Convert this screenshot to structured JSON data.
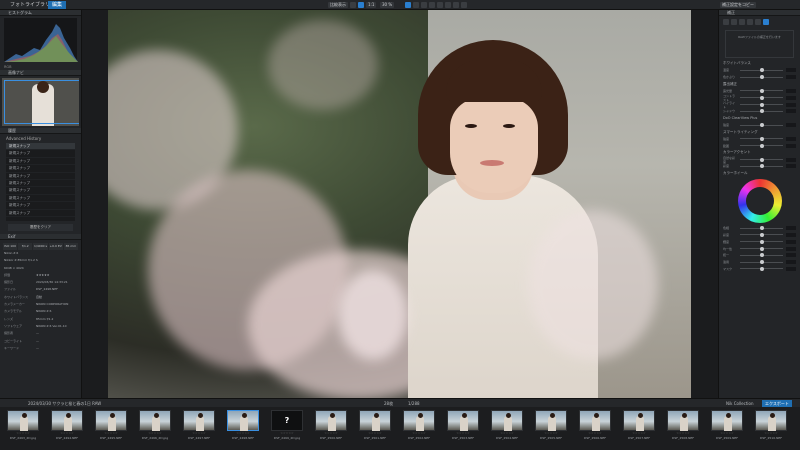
{
  "topbar": {
    "tabs": [
      {
        "label": "フォトライブラリ",
        "active": false
      },
      {
        "label": "編集",
        "active": true
      }
    ],
    "compare_label": "比較表示",
    "zoom_label": "1:1",
    "zoom_value": "30 %",
    "export_label": "補正設定をコピー"
  },
  "left_panel": {
    "histogram_title": "ヒストグラム",
    "histogram_mode": "RGB",
    "navigator_title": "画像ナビ",
    "history_title": "履歴",
    "history_header": "Advanced History",
    "history_items": [
      "新規スナップ",
      "新規スナップ",
      "新規スナップ",
      "新規スナップ",
      "新規スナップ",
      "新規スナップ",
      "新規スナップ",
      "新規スナップ",
      "新規スナップ",
      "新規スナップ"
    ],
    "clear_button": "履歴をクリア",
    "exif_title": "Exif",
    "exif_values": [
      "ISO 100",
      "f/1.2",
      "1/4000 s",
      "+0.0 EV",
      "85 mm"
    ],
    "camera": "Nikon Z 6",
    "lens": "Nikkor Z 85mm f/1.2 S",
    "resolution": "6048 × 4024",
    "info_rows": [
      {
        "k": "評価",
        "v": "★★★★★"
      },
      {
        "k": "撮影日",
        "v": "2024/03/30 14:33:21"
      },
      {
        "k": "ファイル",
        "v": "DSF_2498.NEF"
      },
      {
        "k": "ホワイトバランス",
        "v": "自動"
      },
      {
        "k": "カメラメーカー",
        "v": "NIKON CORPORATION"
      },
      {
        "k": "カメラモデル",
        "v": "NIKON Z 6"
      },
      {
        "k": "レンズ",
        "v": "85mm f/1.2"
      },
      {
        "k": "ソフトウェア",
        "v": "NIKON Z 6 Ver.01.10"
      },
      {
        "k": "撮影者",
        "v": "—"
      },
      {
        "k": "コピーライト",
        "v": "—"
      },
      {
        "k": "キーワード",
        "v": "—"
      }
    ]
  },
  "right_panel": {
    "title": "補正",
    "note_text": "RAWファイルの補正を行います",
    "sections": [
      {
        "title": "ホワイトバランス",
        "rows": [
          "温度",
          "色かぶり"
        ]
      },
      {
        "title": "露出補正",
        "rows": [
          "露光量",
          "コントラスト",
          "ハイライト",
          "シャドウ"
        ]
      },
      {
        "title": "DxO ClearView Plus",
        "rows": [
          "強度"
        ]
      },
      {
        "title": "スマートライティング",
        "rows": [
          "強度",
          "範囲"
        ]
      },
      {
        "title": "カラーアクセント",
        "rows": [
          "自然な彩度",
          "彩度"
        ]
      }
    ],
    "color_label": "カラーホイール",
    "hsl_rows": [
      "色相",
      "彩度",
      "輝度",
      "均一性",
      "統一",
      "適用",
      "マスク"
    ]
  },
  "filmstrip": {
    "path": "2024/03/30 サクラと桜と春の1日 RAW",
    "count_label": "28枚",
    "total_label": "1/288",
    "collection_label": "Nik Collection",
    "export_button": "エクスポート",
    "items": [
      {
        "name": "DSF_2493_2D.jpg",
        "type": "photo"
      },
      {
        "name": "DSF_2494.NEF",
        "type": "photo"
      },
      {
        "name": "DSF_2495.NEF",
        "type": "photo"
      },
      {
        "name": "DSF_2496_2D.jpg",
        "type": "photo"
      },
      {
        "name": "DSF_2497.NEF",
        "type": "photo"
      },
      {
        "name": "DSF_2498.NEF",
        "type": "photo"
      },
      {
        "name": "DSF_2499_2D.jpg",
        "type": "unknown"
      },
      {
        "name": "DSF_2500.NEF",
        "type": "photo"
      },
      {
        "name": "DSF_2501.NEF",
        "type": "photo"
      },
      {
        "name": "DSF_2502.NEF",
        "type": "photo"
      },
      {
        "name": "DSF_2503.NEF",
        "type": "photo"
      },
      {
        "name": "DSF_2504.NEF",
        "type": "photo"
      },
      {
        "name": "DSF_2505.NEF",
        "type": "photo"
      },
      {
        "name": "DSF_2506.NEF",
        "type": "photo"
      },
      {
        "name": "DSF_2507.NEF",
        "type": "photo"
      },
      {
        "name": "DSF_2508.NEF",
        "type": "photo"
      },
      {
        "name": "DSF_2509.NEF",
        "type": "photo"
      },
      {
        "name": "DSF_2510.NEF",
        "type": "photo"
      }
    ]
  },
  "colors": {
    "accent": "#1f6fb3",
    "panel": "#232528",
    "background": "#1b1c1e"
  }
}
